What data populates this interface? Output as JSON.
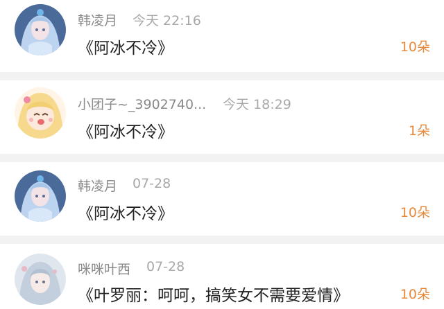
{
  "comments": [
    {
      "user": "韩凌月",
      "time": "今天 22:16",
      "message": "《阿冰不冷》",
      "flowers": "10朵",
      "avatar_icon": "blue-haired-girl-avatar-icon"
    },
    {
      "user": "小团子~_3902740...",
      "time": "今天 18:29",
      "message": "《阿冰不冷》",
      "flowers": "1朵",
      "avatar_icon": "blonde-chibi-girl-avatar-icon"
    },
    {
      "user": "韩凌月",
      "time": "07-28",
      "message": "《阿冰不冷》",
      "flowers": "10朵",
      "avatar_icon": "blue-haired-girl-avatar-icon"
    },
    {
      "user": "咪咪叶西",
      "time": "07-28",
      "message": "《叶罗丽：呵呵，搞笑女不需要爱情》",
      "flowers": "10朵",
      "avatar_icon": "silver-haired-girl-avatar-icon"
    }
  ],
  "colors": {
    "flower_count": "#e8893a",
    "username": "#8a8a8a",
    "separator": "#f2f2f2"
  }
}
